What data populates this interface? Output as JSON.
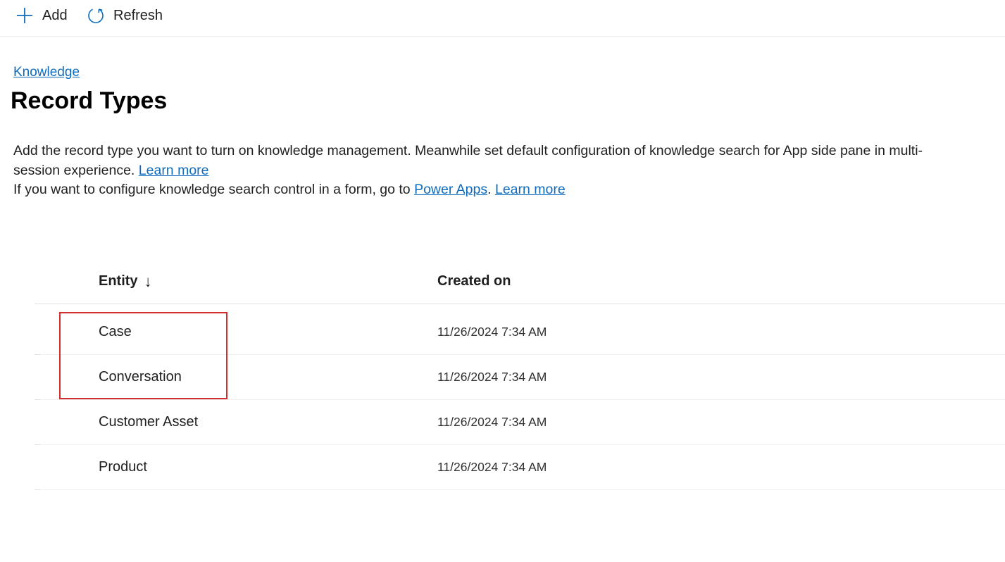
{
  "toolbar": {
    "add_label": "Add",
    "add_icon": "plus-icon",
    "refresh_label": "Refresh",
    "refresh_icon": "refresh-icon"
  },
  "breadcrumb": {
    "label": "Knowledge"
  },
  "page": {
    "title": "Record Types",
    "description_line1": "Add the record type you want to turn on knowledge management. Meanwhile set default configuration of knowledge search for App side pane in multi-",
    "description_line2_prefix": "session experience. ",
    "description_line2_link": "Learn more",
    "description_line3_prefix": "If you want to configure knowledge search control in a form, go to ",
    "description_line3_link1": "Power Apps",
    "description_line3_separator": ". ",
    "description_line3_link2": "Learn more"
  },
  "grid": {
    "columns": {
      "entity": "Entity",
      "entity_sort_icon": "arrow-down-icon",
      "created_on": "Created on"
    },
    "rows": [
      {
        "entity": "Case",
        "created_on": "11/26/2024 7:34 AM"
      },
      {
        "entity": "Conversation",
        "created_on": "11/26/2024 7:34 AM"
      },
      {
        "entity": "Customer Asset",
        "created_on": "11/26/2024 7:34 AM"
      },
      {
        "entity": "Product",
        "created_on": "11/26/2024 7:34 AM"
      }
    ]
  },
  "colors": {
    "link": "#0f6cbd",
    "highlight": "#d32f2f",
    "text": "#201f1e"
  }
}
